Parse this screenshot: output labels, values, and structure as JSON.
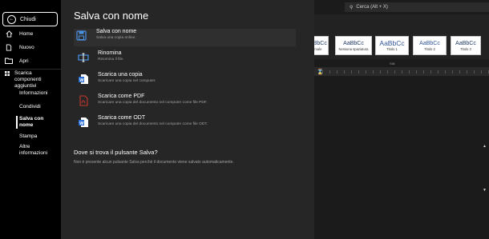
{
  "sidebar": {
    "close": "Chiudi",
    "home": "Home",
    "new": "Nuovo",
    "open": "Apri",
    "addins": "Scarica componenti aggiuntivi",
    "info": "Informazioni",
    "share": "Condividi",
    "saveas": "Salva con nome",
    "print": "Stampa",
    "more": "Altre informazioni"
  },
  "panel": {
    "title": "Salva con nome",
    "options": [
      {
        "title": "Salva con nome",
        "desc": "Salva una copia online.",
        "icon": "save-copy-icon"
      },
      {
        "title": "Rinomina",
        "desc": "Rinomina il file.",
        "icon": "rename-icon"
      },
      {
        "title": "Scarica una copia",
        "desc": "Scaricare una copia nel computer.",
        "icon": "word-doc-icon"
      },
      {
        "title": "Scarica come PDF",
        "desc": "Scaricare una copia del documento nel computer come file PDF.",
        "icon": "pdf-icon"
      },
      {
        "title": "Scarica come ODT",
        "desc": "Scaricare una copia del documento nel computer come file ODT.",
        "icon": "odt-icon"
      }
    ],
    "question_title": "Dove si trova il pulsante Salva?",
    "question_text": "Non è presente alcun pulsante Salva perché il documento viene salvato automaticamente."
  },
  "background": {
    "search_placeholder": "Cerca (Alt + X)",
    "styles": [
      {
        "sample": "AaBbCc",
        "name": "ormale"
      },
      {
        "sample": "AaBbCc",
        "name": "Nessuna spaziatura"
      },
      {
        "sample": "AaBbCc",
        "name": "Titolo 1"
      },
      {
        "sample": "AaBbCc",
        "name": "Titolo 2"
      },
      {
        "sample": "AaBbCc",
        "name": "Titolo 3"
      }
    ],
    "ribbon_label": "Stili"
  },
  "colors": {
    "accent_blue": "#2b6fd6",
    "pdf_red": "#c4382c",
    "panel_bg": "#262626"
  }
}
